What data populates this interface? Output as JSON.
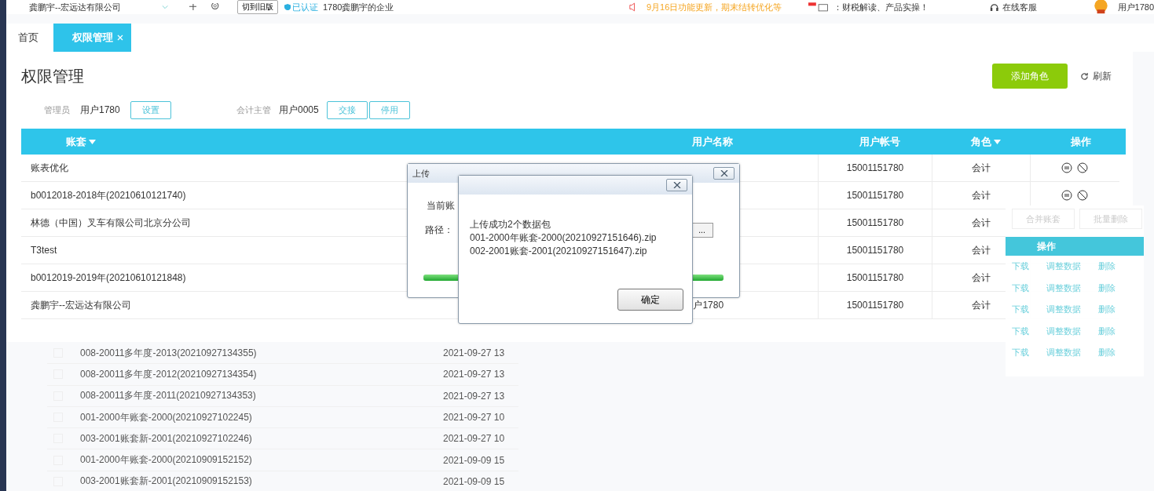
{
  "topbar": {
    "company": "龚鹏宇--宏远达有限公司",
    "switch_button": "切到旧版",
    "verified": "已认证",
    "enterprise": "1780龚鹏宇的企业",
    "notice": "9月16日功能更新，期末结转优化等",
    "promo": "：财税解读、产品实操！",
    "support": "在线客服",
    "user": "用户1780"
  },
  "tabs": [
    {
      "label": "首页",
      "selected": false,
      "closable": false
    },
    {
      "label": "权限管理",
      "selected": true,
      "closable": true
    }
  ],
  "page": {
    "title": "权限管理",
    "add_button": "添加角色",
    "refresh_button": "刷新"
  },
  "roles": [
    {
      "label": "管理员",
      "user": "用户1780",
      "buttons": [
        "设置"
      ]
    },
    {
      "label": "会计主管",
      "user": "用户0005",
      "buttons": [
        "交接",
        "停用"
      ]
    }
  ],
  "table": {
    "columns": [
      {
        "label": "账套",
        "sortable": true
      },
      {
        "label": "用户名称",
        "sortable": false
      },
      {
        "label": "用户帐号",
        "sortable": false
      },
      {
        "label": "角色",
        "sortable": true
      },
      {
        "label": "操作",
        "sortable": false
      }
    ],
    "rows": [
      {
        "account": "账表优化",
        "account_no": "15001151780",
        "role": "会计",
        "action_icons": true
      },
      {
        "account": "b0012018-2018年(20210610121740)",
        "account_no": "15001151780",
        "role": "会计",
        "action_icons": true
      },
      {
        "account": "林德（中国）叉车有限公司北京分公司",
        "account_no": "15001151780",
        "role": "会计"
      },
      {
        "account": "T3test",
        "account_no": "15001151780",
        "role": "会计"
      },
      {
        "account": "b0012019-2019年(20210610121848)",
        "account_no": "15001151780",
        "role": "会计"
      },
      {
        "account": "龚鹏宇--宏远达有限公司",
        "user_name": "户1780",
        "account_no": "15001151780",
        "role": "会计"
      }
    ]
  },
  "back_list": [
    {
      "name": "008-20011多年度-2013(20210927134355)",
      "date": "2021-09-27 13",
      "checked": false
    },
    {
      "name": "008-20011多年度-2012(20210927134354)",
      "date": "2021-09-27 13",
      "checked": false
    },
    {
      "name": "008-20011多年度-2011(20210927134353)",
      "date": "2021-09-27 13",
      "checked": false
    },
    {
      "name": "001-2000年账套-2000(20210927102245)",
      "date": "2021-09-27 10",
      "checked": false
    },
    {
      "name": "003-2001账套新-2001(20210927102246)",
      "date": "2021-09-27 10",
      "checked": false
    },
    {
      "name": "001-2000年账套-2000(20210909152152)",
      "date": "2021-09-09 15",
      "checked": false
    },
    {
      "name": "003-2001账套新-2001(20210909152153)",
      "date": "2021-09-09 15",
      "checked": false
    }
  ],
  "back_panel": {
    "buttons": [
      "合并账套",
      "批量删除"
    ],
    "header": "操作",
    "rows": [
      [
        "下载",
        "调整数据",
        "删除"
      ],
      [
        "下载",
        "调整数据",
        "删除"
      ],
      [
        "下载",
        "调整数据",
        "删除"
      ],
      [
        "下载",
        "调整数据",
        "删除"
      ],
      [
        "下载",
        "调整数据",
        "删除"
      ]
    ]
  },
  "upload_dialog": {
    "title": "上传",
    "current_label": "当前账",
    "path_label": "路径：",
    "browse_button": "...",
    "progress": {
      "level": 1
    }
  },
  "message_dialog": {
    "lines": [
      "上传成功2个数据包",
      "001-2000年账套-2000(20210927151646).zip",
      "002-2001账套-2001(20210927151647).zip"
    ],
    "ok_button": "确定"
  }
}
